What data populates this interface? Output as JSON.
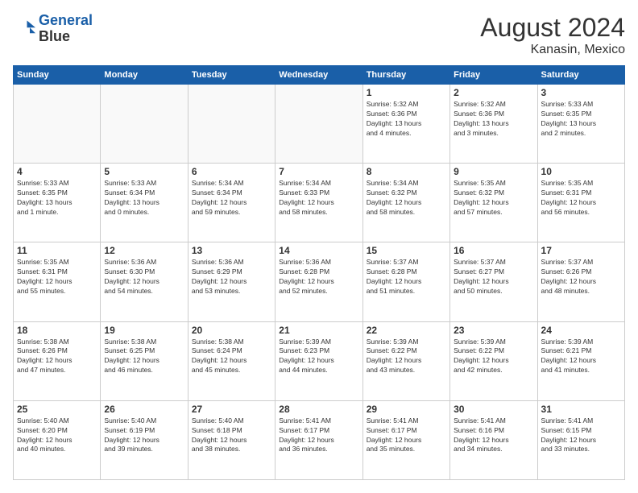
{
  "header": {
    "logo_line1": "General",
    "logo_line2": "Blue",
    "title": "August 2024",
    "subtitle": "Kanasin, Mexico"
  },
  "days_of_week": [
    "Sunday",
    "Monday",
    "Tuesday",
    "Wednesday",
    "Thursday",
    "Friday",
    "Saturday"
  ],
  "weeks": [
    [
      {
        "day": "",
        "info": ""
      },
      {
        "day": "",
        "info": ""
      },
      {
        "day": "",
        "info": ""
      },
      {
        "day": "",
        "info": ""
      },
      {
        "day": "1",
        "info": "Sunrise: 5:32 AM\nSunset: 6:36 PM\nDaylight: 13 hours\nand 4 minutes."
      },
      {
        "day": "2",
        "info": "Sunrise: 5:32 AM\nSunset: 6:36 PM\nDaylight: 13 hours\nand 3 minutes."
      },
      {
        "day": "3",
        "info": "Sunrise: 5:33 AM\nSunset: 6:35 PM\nDaylight: 13 hours\nand 2 minutes."
      }
    ],
    [
      {
        "day": "4",
        "info": "Sunrise: 5:33 AM\nSunset: 6:35 PM\nDaylight: 13 hours\nand 1 minute."
      },
      {
        "day": "5",
        "info": "Sunrise: 5:33 AM\nSunset: 6:34 PM\nDaylight: 13 hours\nand 0 minutes."
      },
      {
        "day": "6",
        "info": "Sunrise: 5:34 AM\nSunset: 6:34 PM\nDaylight: 12 hours\nand 59 minutes."
      },
      {
        "day": "7",
        "info": "Sunrise: 5:34 AM\nSunset: 6:33 PM\nDaylight: 12 hours\nand 58 minutes."
      },
      {
        "day": "8",
        "info": "Sunrise: 5:34 AM\nSunset: 6:32 PM\nDaylight: 12 hours\nand 58 minutes."
      },
      {
        "day": "9",
        "info": "Sunrise: 5:35 AM\nSunset: 6:32 PM\nDaylight: 12 hours\nand 57 minutes."
      },
      {
        "day": "10",
        "info": "Sunrise: 5:35 AM\nSunset: 6:31 PM\nDaylight: 12 hours\nand 56 minutes."
      }
    ],
    [
      {
        "day": "11",
        "info": "Sunrise: 5:35 AM\nSunset: 6:31 PM\nDaylight: 12 hours\nand 55 minutes."
      },
      {
        "day": "12",
        "info": "Sunrise: 5:36 AM\nSunset: 6:30 PM\nDaylight: 12 hours\nand 54 minutes."
      },
      {
        "day": "13",
        "info": "Sunrise: 5:36 AM\nSunset: 6:29 PM\nDaylight: 12 hours\nand 53 minutes."
      },
      {
        "day": "14",
        "info": "Sunrise: 5:36 AM\nSunset: 6:28 PM\nDaylight: 12 hours\nand 52 minutes."
      },
      {
        "day": "15",
        "info": "Sunrise: 5:37 AM\nSunset: 6:28 PM\nDaylight: 12 hours\nand 51 minutes."
      },
      {
        "day": "16",
        "info": "Sunrise: 5:37 AM\nSunset: 6:27 PM\nDaylight: 12 hours\nand 50 minutes."
      },
      {
        "day": "17",
        "info": "Sunrise: 5:37 AM\nSunset: 6:26 PM\nDaylight: 12 hours\nand 48 minutes."
      }
    ],
    [
      {
        "day": "18",
        "info": "Sunrise: 5:38 AM\nSunset: 6:26 PM\nDaylight: 12 hours\nand 47 minutes."
      },
      {
        "day": "19",
        "info": "Sunrise: 5:38 AM\nSunset: 6:25 PM\nDaylight: 12 hours\nand 46 minutes."
      },
      {
        "day": "20",
        "info": "Sunrise: 5:38 AM\nSunset: 6:24 PM\nDaylight: 12 hours\nand 45 minutes."
      },
      {
        "day": "21",
        "info": "Sunrise: 5:39 AM\nSunset: 6:23 PM\nDaylight: 12 hours\nand 44 minutes."
      },
      {
        "day": "22",
        "info": "Sunrise: 5:39 AM\nSunset: 6:22 PM\nDaylight: 12 hours\nand 43 minutes."
      },
      {
        "day": "23",
        "info": "Sunrise: 5:39 AM\nSunset: 6:22 PM\nDaylight: 12 hours\nand 42 minutes."
      },
      {
        "day": "24",
        "info": "Sunrise: 5:39 AM\nSunset: 6:21 PM\nDaylight: 12 hours\nand 41 minutes."
      }
    ],
    [
      {
        "day": "25",
        "info": "Sunrise: 5:40 AM\nSunset: 6:20 PM\nDaylight: 12 hours\nand 40 minutes."
      },
      {
        "day": "26",
        "info": "Sunrise: 5:40 AM\nSunset: 6:19 PM\nDaylight: 12 hours\nand 39 minutes."
      },
      {
        "day": "27",
        "info": "Sunrise: 5:40 AM\nSunset: 6:18 PM\nDaylight: 12 hours\nand 38 minutes."
      },
      {
        "day": "28",
        "info": "Sunrise: 5:41 AM\nSunset: 6:17 PM\nDaylight: 12 hours\nand 36 minutes."
      },
      {
        "day": "29",
        "info": "Sunrise: 5:41 AM\nSunset: 6:17 PM\nDaylight: 12 hours\nand 35 minutes."
      },
      {
        "day": "30",
        "info": "Sunrise: 5:41 AM\nSunset: 6:16 PM\nDaylight: 12 hours\nand 34 minutes."
      },
      {
        "day": "31",
        "info": "Sunrise: 5:41 AM\nSunset: 6:15 PM\nDaylight: 12 hours\nand 33 minutes."
      }
    ]
  ],
  "colors": {
    "header_bg": "#1a5fa8",
    "header_text": "#ffffff",
    "border": "#cccccc",
    "empty_bg": "#f9f9f9"
  }
}
